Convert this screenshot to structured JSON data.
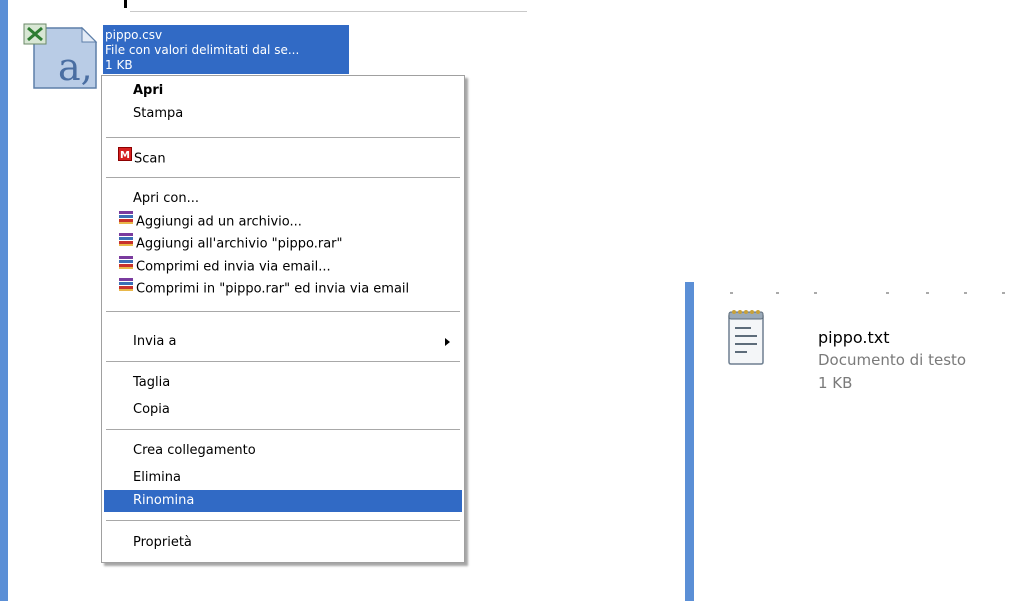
{
  "selected_file": {
    "name": "pippo.csv",
    "type": "File con valori delimitati dal se...",
    "size": "1 KB",
    "icon": "excel-csv-file-icon"
  },
  "context_menu": {
    "items": [
      {
        "label": "Apri",
        "bold": true
      },
      {
        "label": "Stampa"
      },
      {
        "label": "Scan",
        "icon": "mcafee-scan-icon"
      },
      {
        "label": "Apri con..."
      },
      {
        "label": "Aggiungi ad un archivio...",
        "icon": "winrar-icon"
      },
      {
        "label": "Aggiungi all'archivio \"pippo.rar\"",
        "icon": "winrar-icon"
      },
      {
        "label": "Comprimi ed invia via email...",
        "icon": "winrar-icon"
      },
      {
        "label": "Comprimi in \"pippo.rar\" ed invia via email",
        "icon": "winrar-icon"
      },
      {
        "label": "Invia a",
        "submenu": true
      },
      {
        "label": "Taglia"
      },
      {
        "label": "Copia"
      },
      {
        "label": "Crea collegamento"
      },
      {
        "label": "Elimina"
      },
      {
        "label": "Rinomina",
        "highlighted": true
      },
      {
        "label": "Proprietà"
      }
    ]
  },
  "renamed_file": {
    "name": "pippo.txt",
    "type": "Documento di testo",
    "size": "1 KB",
    "icon": "notepad-file-icon"
  },
  "colors": {
    "selection": "#316ac5",
    "pane_accent": "#5b8fd6",
    "menu_border": "#a0a0a0",
    "secondary_text": "#7a7a7a"
  }
}
